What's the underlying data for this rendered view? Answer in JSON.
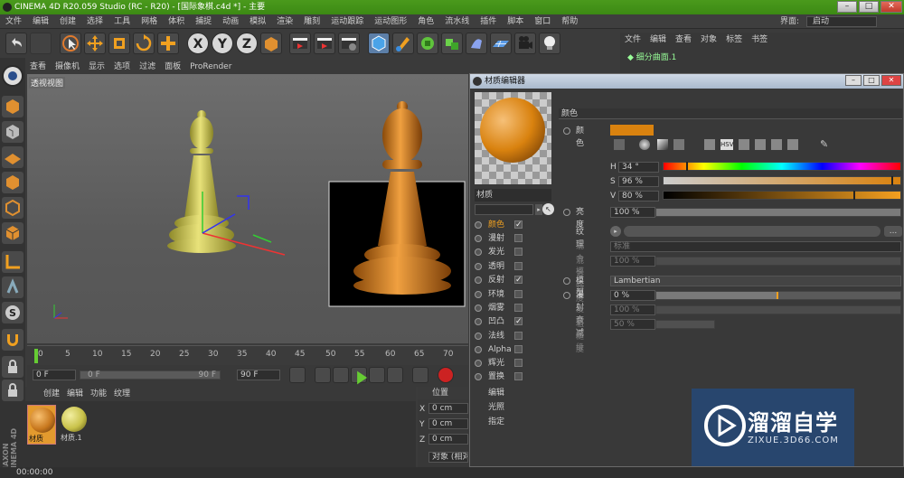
{
  "title_bar": {
    "text": "CINEMA 4D R20.059 Studio (RC - R20) - [国际象棋.c4d *] - 主要"
  },
  "menu": {
    "items": [
      "文件",
      "编辑",
      "创建",
      "选择",
      "工具",
      "网格",
      "体积",
      "捕捉",
      "动画",
      "模拟",
      "渲染",
      "雕刻",
      "运动跟踪",
      "运动图形",
      "角色",
      "流水线",
      "插件",
      "脚本",
      "窗口",
      "帮助"
    ],
    "layout_label": "界面:",
    "layout_value": "启动"
  },
  "toolbar": {
    "buttons": [
      "undo-icon",
      "redo-icon",
      "live-selection-icon",
      "move-icon",
      "scale-icon",
      "rotate-icon",
      "add-icon",
      "x-axis-icon",
      "y-axis-icon",
      "z-axis-icon",
      "coord-system-icon",
      "render-view-icon",
      "render-picture-icon",
      "render-settings-icon",
      "cube-icon",
      "pen-icon",
      "subdivision-icon",
      "array-icon",
      "deformer-icon",
      "floor-icon",
      "camera-icon",
      "light-icon"
    ]
  },
  "viewport": {
    "menu": [
      "查看",
      "摄像机",
      "显示",
      "选项",
      "过滤",
      "面板",
      "ProRender"
    ],
    "label": "透视视图"
  },
  "timeline": {
    "ticks": [
      "0",
      "5",
      "10",
      "15",
      "20",
      "25",
      "30",
      "35",
      "40",
      "45",
      "50",
      "55",
      "60",
      "65",
      "70"
    ]
  },
  "transport": {
    "start": "0 F",
    "current": "0 F",
    "range_end": "90 F",
    "end": "90 F"
  },
  "material_manager": {
    "menu": [
      "创建",
      "编辑",
      "功能",
      "纹理"
    ],
    "materials": [
      {
        "name": "材质",
        "color": "#c8781e"
      },
      {
        "name": "材质.1",
        "color": "#c9c24a"
      }
    ]
  },
  "coords": {
    "title": "位置",
    "rows": [
      {
        "axis": "X",
        "value": "0 cm"
      },
      {
        "axis": "Y",
        "value": "0 cm"
      },
      {
        "axis": "Z",
        "value": "0 cm"
      }
    ],
    "button": "对象 (相对)"
  },
  "object_manager": {
    "tabs": [
      "文件",
      "编辑",
      "查看",
      "对象",
      "标签",
      "书签"
    ],
    "object": "细分曲面.1"
  },
  "material_editor": {
    "title": "材质编辑器",
    "material_name": "材质",
    "section": "颜色",
    "color_label": "颜色",
    "color_hex": "#d9820f",
    "hsv": [
      {
        "label": "H",
        "value": "34 °",
        "fraction": 0.094
      },
      {
        "label": "S",
        "value": "96 %",
        "fraction": 0.96
      },
      {
        "label": "V",
        "value": "80 %",
        "fraction": 0.8
      }
    ],
    "mode_button": "HSV",
    "brightness_label": "亮度",
    "brightness_value": "100 %",
    "texture_label": "纹理",
    "mix_mode_label": "混合模式",
    "mix_mode_value": "标准",
    "mix_strength_label": "混合强度",
    "mix_strength_value": "100 %",
    "model_label": "模型",
    "model_value": "Lambertian",
    "diffuse_falloff_label": "漫射衰减",
    "diffuse_falloff_value": "0 %",
    "diffuse_level_label": "漫射层级",
    "diffuse_level_value": "100 %",
    "roughness_label": "粗糙度",
    "roughness_value": "50 %",
    "channels": [
      {
        "name": "颜色",
        "checked": true,
        "active": true
      },
      {
        "name": "漫射",
        "checked": false
      },
      {
        "name": "发光",
        "checked": false
      },
      {
        "name": "透明",
        "checked": false
      },
      {
        "name": "反射",
        "checked": true
      },
      {
        "name": "环境",
        "checked": false
      },
      {
        "name": "烟雾",
        "checked": false
      },
      {
        "name": "凹凸",
        "checked": true
      },
      {
        "name": "法线",
        "checked": false
      },
      {
        "name": "Alpha",
        "checked": false
      },
      {
        "name": "辉光",
        "checked": false
      },
      {
        "name": "置换",
        "checked": false
      }
    ],
    "extra": [
      "编辑",
      "光照",
      "指定"
    ]
  },
  "watermark": {
    "text": "溜溜自学",
    "url": "ZIXUE.3D66.COM"
  },
  "status": {
    "time": "00:00:00"
  },
  "brand": {
    "line1": "MAXON",
    "line2": "CINEMA 4D"
  }
}
